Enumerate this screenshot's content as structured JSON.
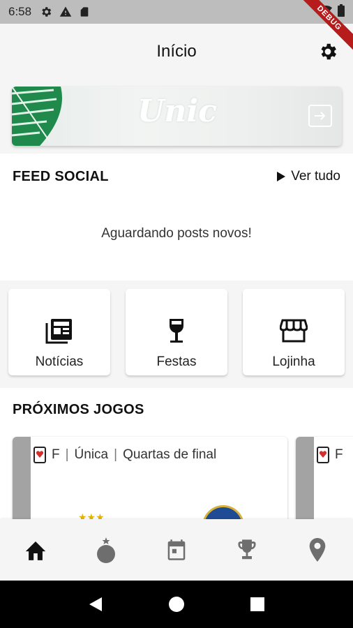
{
  "status_bar": {
    "time": "6:58",
    "icons": [
      "gear-icon",
      "warning-icon",
      "sd-card-icon",
      "wifi-icon",
      "battery-icon"
    ]
  },
  "debug_banner": "DEBUG",
  "app_bar": {
    "title": "Início",
    "settings_icon": "gear-icon"
  },
  "banner": {
    "brand": "Unic",
    "action_icon": "arrow-right-box-icon"
  },
  "feed": {
    "title": "FEED SOCIAL",
    "see_all": "Ver tudo",
    "empty_message": "Aguardando posts novos!"
  },
  "shortcuts": [
    {
      "label": "Notícias",
      "icon": "newspaper-icon"
    },
    {
      "label": "Festas",
      "icon": "wine-glass-icon"
    },
    {
      "label": "Lojinha",
      "icon": "storefront-icon"
    }
  ],
  "games": {
    "title": "PRÓXIMOS JOGOS",
    "cards": [
      {
        "gender": "F",
        "phase_type": "Única",
        "stage": "Quartas de final"
      },
      {
        "gender": "F"
      }
    ]
  },
  "bottom_nav": [
    {
      "name": "home-icon",
      "active": true
    },
    {
      "name": "ball-icon",
      "active": false
    },
    {
      "name": "calendar-icon",
      "active": false
    },
    {
      "name": "trophy-icon",
      "active": false
    },
    {
      "name": "location-pin-icon",
      "active": false
    }
  ],
  "colors": {
    "debug": "#b71c1c",
    "nav_active": "#111111",
    "nav_inactive": "#6e6e6e",
    "game_bar": "#a3a3a3"
  }
}
